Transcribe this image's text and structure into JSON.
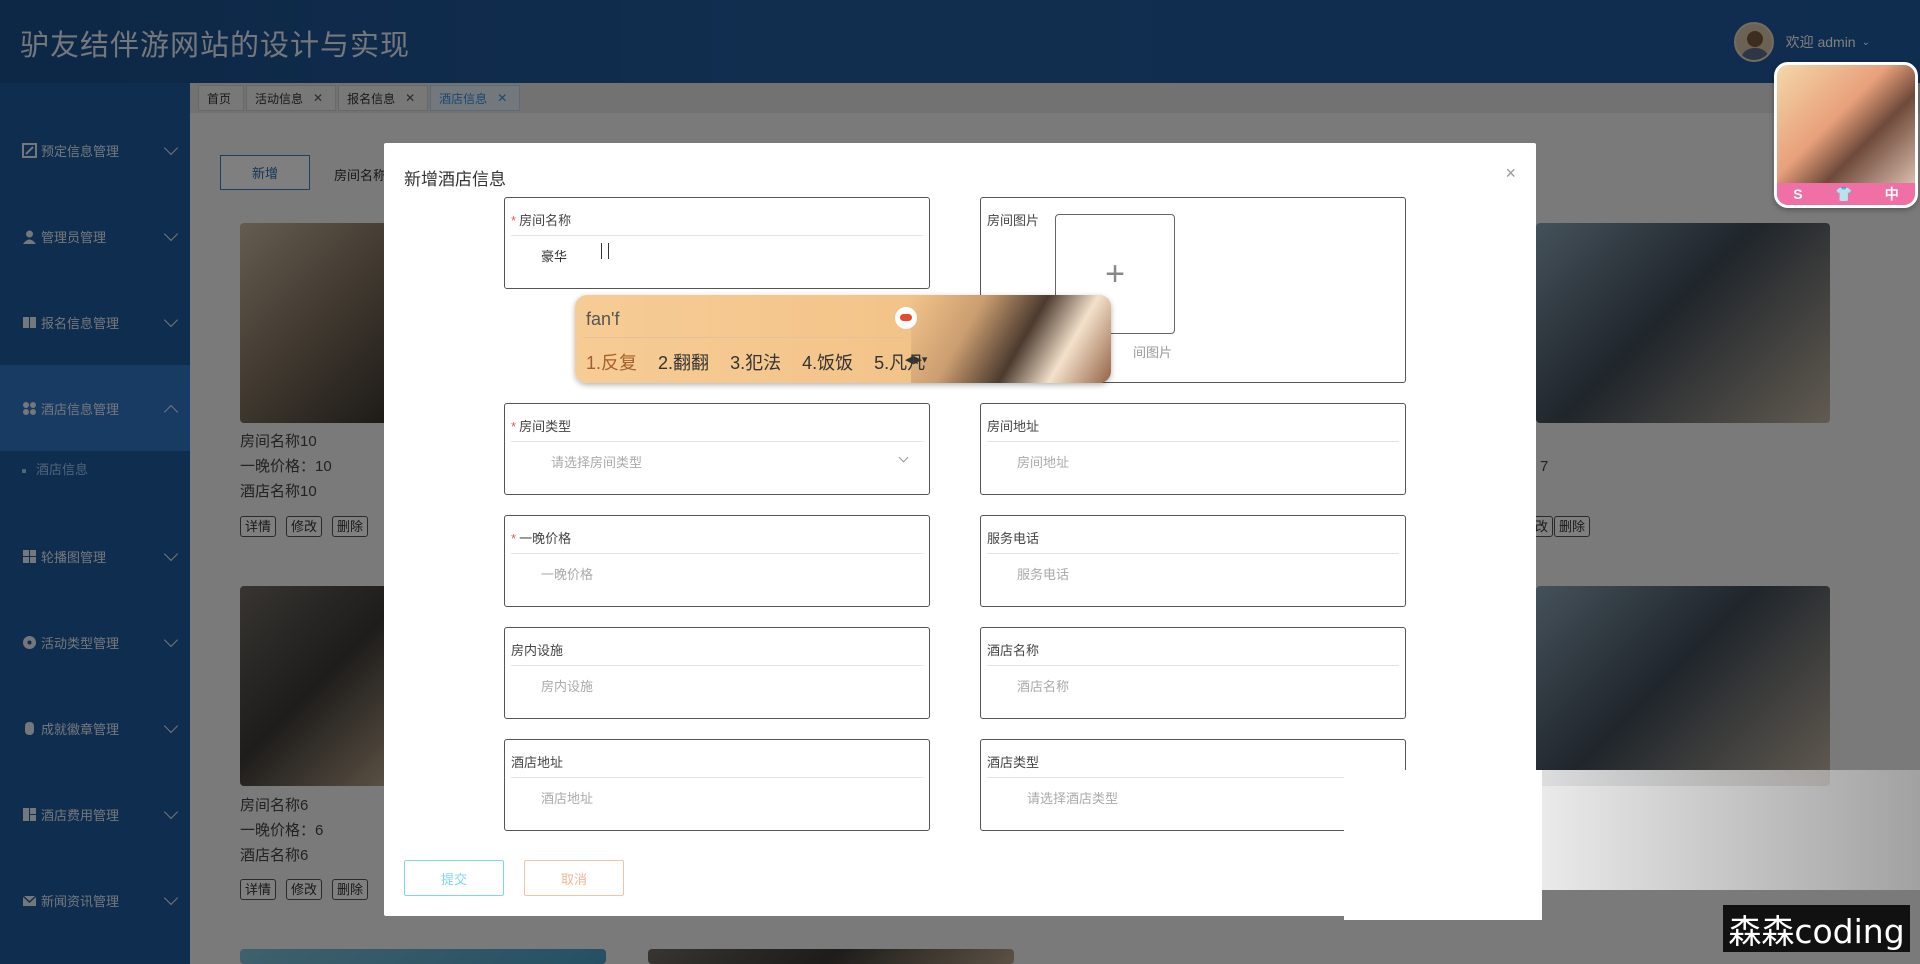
{
  "header": {
    "title": "驴友结伴游网站的设计与实现",
    "user_label": "欢迎 admin"
  },
  "sidebar": {
    "items": [
      {
        "label": "预定信息管理"
      },
      {
        "label": "管理员管理"
      },
      {
        "label": "报名信息管理"
      },
      {
        "label": "酒店信息管理"
      },
      {
        "label": "轮播图管理"
      },
      {
        "label": "活动类型管理"
      },
      {
        "label": "成就徽章管理"
      },
      {
        "label": "酒店费用管理"
      },
      {
        "label": "新闻资讯管理"
      }
    ],
    "sub_item": "酒店信息"
  },
  "tabs": [
    {
      "label": "首页"
    },
    {
      "label": "活动信息"
    },
    {
      "label": "报名信息"
    },
    {
      "label": "酒店信息"
    }
  ],
  "toolbar": {
    "new_label": "新增",
    "search_label": "房间名称"
  },
  "cards": [
    {
      "name": "房间名称10",
      "price": "一晚价格：10",
      "hotel": "酒店名称10"
    },
    {
      "name": "房间名称6",
      "price": "一晚价格：6",
      "hotel": "酒店名称6"
    },
    {
      "price_partial": "7"
    }
  ],
  "card_buttons": {
    "detail": "详情",
    "edit": "修改",
    "delete": "删除",
    "edit_partial": "改"
  },
  "dialog": {
    "title": "新增酒店信息",
    "close": "×",
    "fields": {
      "room_name": {
        "label": "房间名称",
        "value": "豪华"
      },
      "room_image": {
        "label": "房间图片",
        "hint": "间图片",
        "plus": "+"
      },
      "room_type": {
        "label": "房间类型",
        "placeholder": "请选择房间类型"
      },
      "room_address": {
        "label": "房间地址",
        "placeholder": "房间地址"
      },
      "price": {
        "label": "一晚价格",
        "placeholder": "一晚价格"
      },
      "phone": {
        "label": "服务电话",
        "placeholder": "服务电话"
      },
      "facilities": {
        "label": "房内设施",
        "placeholder": "房内设施"
      },
      "hotel_name": {
        "label": "酒店名称",
        "placeholder": "酒店名称"
      },
      "hotel_address": {
        "label": "酒店地址",
        "placeholder": "酒店地址"
      },
      "hotel_type": {
        "label": "酒店类型",
        "placeholder": "请选择酒店类型"
      }
    },
    "submit": "提交",
    "cancel": "取消"
  },
  "ime": {
    "composition": "fan'f",
    "candidates": [
      "1.反复",
      "2.翻翻",
      "3.犯法",
      "4.饭饭",
      "5.凡凡"
    ]
  },
  "skin_widget": {
    "s": "S",
    "shirt": "👕",
    "zh": "中"
  },
  "watermark": "森森coding"
}
